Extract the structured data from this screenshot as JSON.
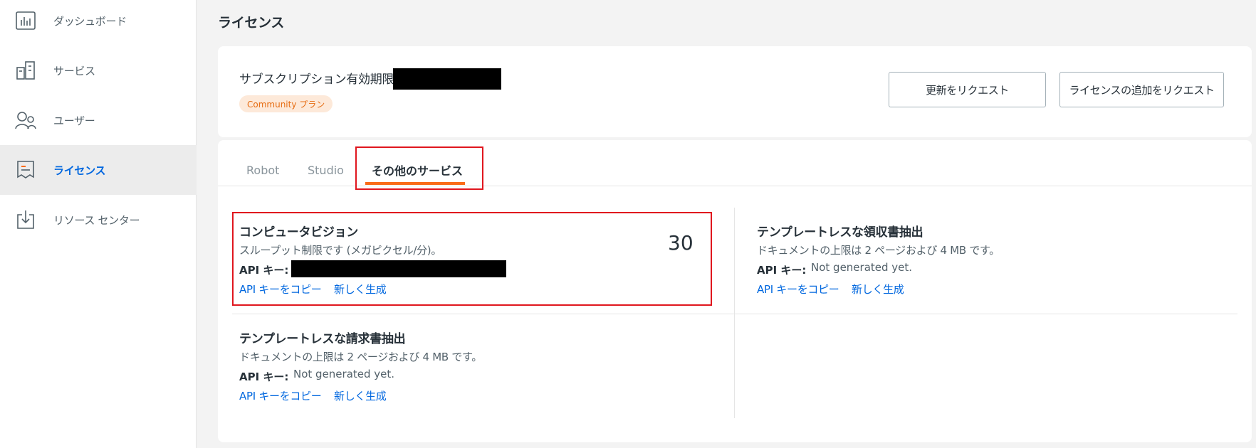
{
  "sidebar": {
    "items": [
      {
        "label": "ダッシュボード",
        "icon": "dashboard-chart-icon"
      },
      {
        "label": "サービス",
        "icon": "services-building-icon"
      },
      {
        "label": "ユーザー",
        "icon": "users-icon"
      },
      {
        "label": "ライセンス",
        "icon": "license-receipt-icon",
        "active": true
      },
      {
        "label": "リソース センター",
        "icon": "download-tray-icon"
      }
    ]
  },
  "page": {
    "title": "ライセンス"
  },
  "subscription": {
    "label": "サブスクリプション有効期限:",
    "plan_badge": "Community プラン",
    "request_renewal_label": "更新をリクエスト",
    "request_more_licenses_label": "ライセンスの追加をリクエスト"
  },
  "tabs": [
    {
      "label": "Robot"
    },
    {
      "label": "Studio"
    },
    {
      "label": "その他のサービス",
      "active": true
    }
  ],
  "services": [
    {
      "title": "コンピュータビジョン",
      "description": "スループット制限です (メガピクセル/分)。",
      "count": "30",
      "api_key_label": "API キー:",
      "api_key_value": "",
      "copy_link": "API キーをコピー",
      "generate_link": "新しく生成"
    },
    {
      "title": "テンプレートレスな領収書抽出",
      "description": "ドキュメントの上限は 2 ページおよび 4 MB です。",
      "api_key_label": "API キー:",
      "api_key_value": "Not generated yet.",
      "copy_link": "API キーをコピー",
      "generate_link": "新しく生成"
    },
    {
      "title": "テンプレートレスな請求書抽出",
      "description": "ドキュメントの上限は 2 ページおよび 4 MB です。",
      "api_key_label": "API キー:",
      "api_key_value": "Not generated yet.",
      "copy_link": "API キーをコピー",
      "generate_link": "新しく生成"
    }
  ],
  "colors": {
    "accent_blue": "#0067df",
    "tab_underline_orange": "#fa6b18",
    "highlight_red": "#e0161e",
    "badge_bg": "#fde9d9",
    "badge_text": "#e66d13"
  }
}
